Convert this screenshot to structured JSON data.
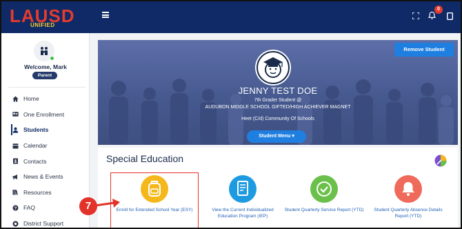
{
  "topbar": {
    "logo_main": "LAUSD",
    "logo_sub": "UNIFIED",
    "notification_count": "0"
  },
  "sidebar": {
    "welcome": "Welcome, Mark",
    "role": "Parent",
    "items": [
      {
        "label": "Home",
        "icon": "home-icon"
      },
      {
        "label": "One Enrollment",
        "icon": "id-card-icon"
      },
      {
        "label": "Students",
        "icon": "user-icon"
      },
      {
        "label": "Calendar",
        "icon": "calendar-icon"
      },
      {
        "label": "Contacts",
        "icon": "contacts-icon"
      },
      {
        "label": "News & Events",
        "icon": "megaphone-icon"
      },
      {
        "label": "Resources",
        "icon": "books-icon"
      },
      {
        "label": "FAQ",
        "icon": "question-icon"
      },
      {
        "label": "District Support",
        "icon": "support-icon"
      }
    ],
    "active_index": 2
  },
  "banner": {
    "remove_button": "Remove Student",
    "student_name": "JENNY TEST DOE",
    "grade_line": "7th Grader Student @",
    "school_line": "AUDUBON MIDDLE SCHOOL GIFTED/HIGH ACHIEVER MAGNET",
    "community_line": "Heet (C/d) Community Of Schools",
    "menu_button": "Student Menu ▾"
  },
  "special_education": {
    "title": "Special Education",
    "tiles": [
      {
        "label": "Enroll for Extended School Year (ESY)",
        "icon": "backpack-icon",
        "color": "#f5b81c"
      },
      {
        "label": "View the Current Individualized Education Program (IEP)",
        "icon": "document-icon",
        "color": "#1e9be0"
      },
      {
        "label": "Student Quarterly Service Report (YTD)",
        "icon": "check-badge-icon",
        "color": "#6ac04a"
      },
      {
        "label": "Student Quarterly Absence Details Report (YTD)",
        "icon": "bell-icon",
        "color": "#ef6a5a"
      }
    ]
  },
  "annotation": {
    "step_number": "7"
  },
  "colors": {
    "header": "#0f2a66",
    "accent": "#1f7fe0",
    "highlight": "#e3322a"
  }
}
